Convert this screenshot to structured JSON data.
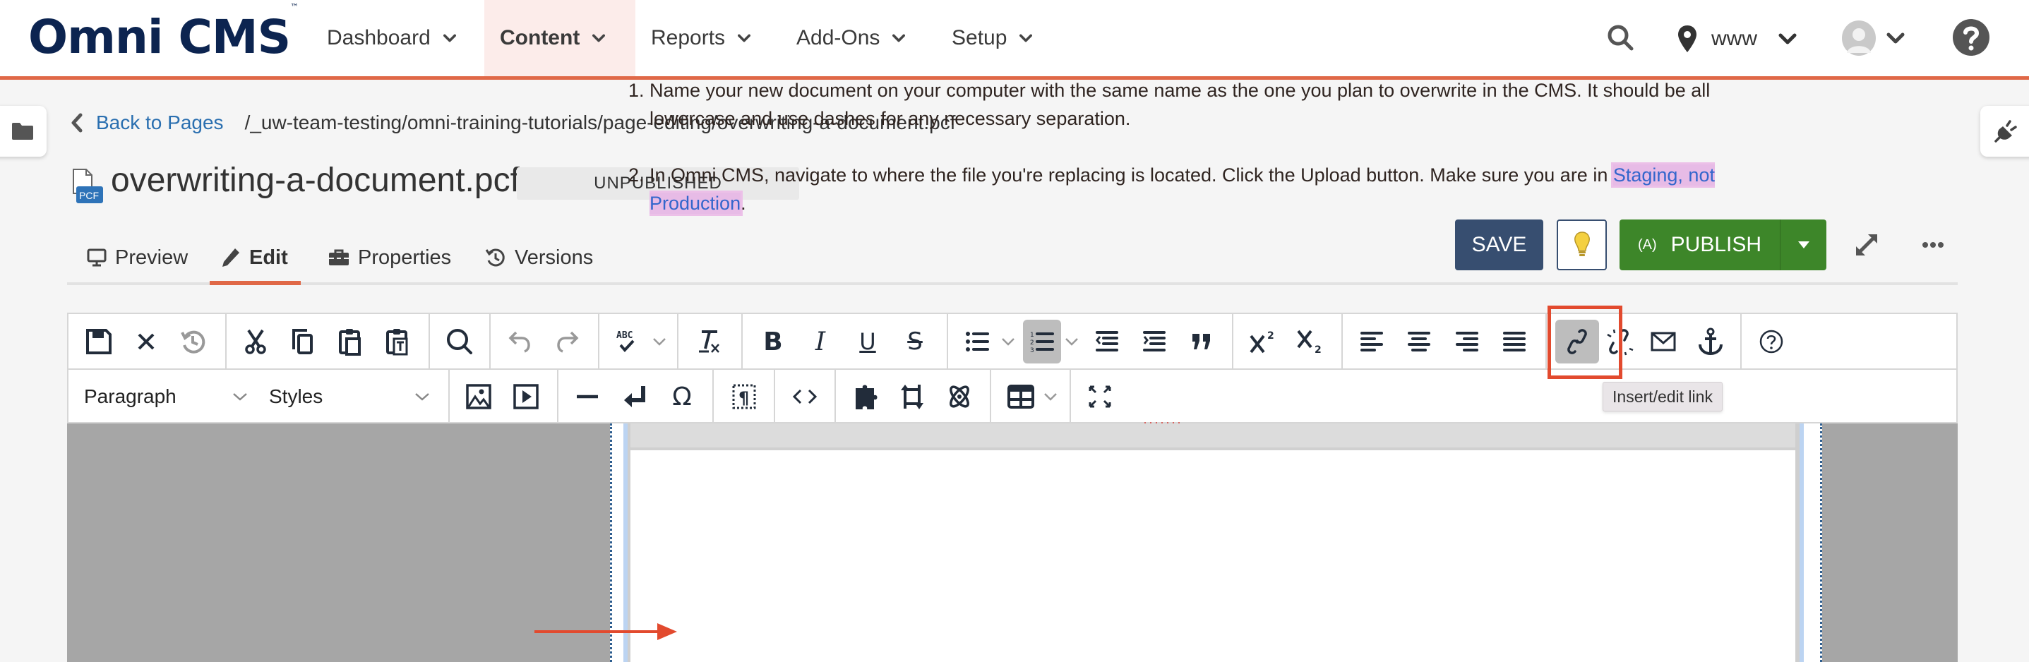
{
  "app": {
    "logo": "Omni CMS",
    "logo_mark": "™"
  },
  "nav": {
    "items": [
      {
        "label": "Dashboard",
        "active": false
      },
      {
        "label": "Content",
        "active": true
      },
      {
        "label": "Reports",
        "active": false
      },
      {
        "label": "Add-Ons",
        "active": false
      },
      {
        "label": "Setup",
        "active": false
      }
    ],
    "site_selector": "www",
    "icons": {
      "search": "search-icon",
      "location": "map-marker-icon",
      "user": "user-avatar",
      "help": "question-circle-icon"
    }
  },
  "breadcrumb": {
    "back_label": "Back to Pages",
    "path": "/_uw-team-testing/omni-training-tutorials/page-editing/overwriting-a-document.pcf"
  },
  "page": {
    "file_badge": "PCF",
    "title": "overwriting-a-document.pcf",
    "status": "UNPUBLISHED"
  },
  "tabs": [
    {
      "label": "Preview",
      "icon": "monitor-icon",
      "active": false
    },
    {
      "label": "Edit",
      "icon": "pencil-icon",
      "active": true
    },
    {
      "label": "Properties",
      "icon": "toolbox-icon",
      "active": false
    },
    {
      "label": "Versions",
      "icon": "history-icon",
      "active": false
    }
  ],
  "actions": {
    "save": "SAVE",
    "publish": "PUBLISH",
    "publish_icon_text": "(A)"
  },
  "toolbar": {
    "format_select": "Paragraph",
    "styles_select": "Styles",
    "tooltip": "Insert/edit link",
    "active_buttons": [
      "numbered-list",
      "insert-edit-link"
    ]
  },
  "editor": {
    "header_band_text": "·······",
    "list_items": [
      {
        "text": "Name your new document on your computer with the same name as the one you plan to overwrite in the CMS. It should be all lowercase and use dashes for any necessary separation."
      },
      {
        "text_before": "In Omni CMS, navigate to where the file you're replacing is located. Click the Upload button. Make sure you are in ",
        "selected_text": "Staging, not Production",
        "text_after": "."
      }
    ]
  },
  "colors": {
    "brand_navy": "#0c2450",
    "accent_orange": "#e06847",
    "save_blue": "#374e70",
    "publish_green": "#3d8629",
    "link_blue": "#2a6fb0",
    "annotation_red": "#e24a2e",
    "selection_pink": "#e7bbe6"
  }
}
